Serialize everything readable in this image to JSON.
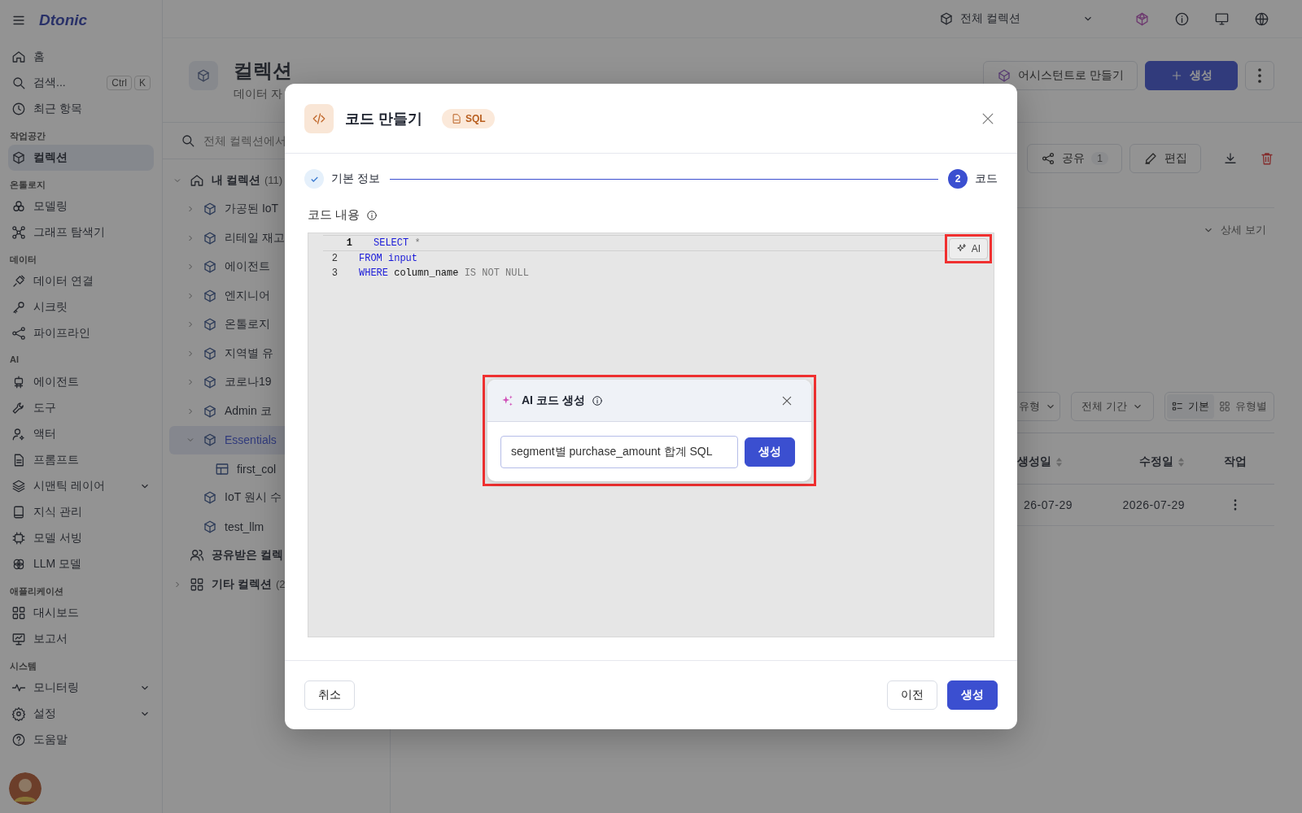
{
  "topbar": {
    "logo": "Dtonic",
    "scope": "전체 컬렉션"
  },
  "sidebar": {
    "groups": [
      {
        "items": [
          {
            "label": "홈",
            "selected": false
          },
          {
            "label": "검색...",
            "selected": false,
            "shortcut": [
              "Ctrl",
              "K"
            ]
          },
          {
            "label": "최근 항목",
            "selected": false
          }
        ]
      },
      {
        "heading": "작업공간",
        "items": [
          {
            "label": "컬렉션",
            "selected": true
          }
        ]
      },
      {
        "heading": "온톨로지",
        "items": [
          {
            "label": "모델링",
            "selected": false
          },
          {
            "label": "그래프 탐색기",
            "selected": false
          }
        ]
      },
      {
        "heading": "데이터",
        "items": [
          {
            "label": "데이터 연결",
            "selected": false
          },
          {
            "label": "시크릿",
            "selected": false
          },
          {
            "label": "파이프라인",
            "selected": false
          }
        ]
      },
      {
        "heading": "AI",
        "items": [
          {
            "label": "에이전트",
            "selected": false
          },
          {
            "label": "도구",
            "selected": false
          },
          {
            "label": "액터",
            "selected": false
          },
          {
            "label": "프롬프트",
            "selected": false
          },
          {
            "label": "시맨틱 레이어",
            "selected": false,
            "expanded": false
          },
          {
            "label": "지식 관리",
            "selected": false
          },
          {
            "label": "모델 서빙",
            "selected": false
          },
          {
            "label": "LLM 모델",
            "selected": false
          }
        ]
      },
      {
        "heading": "애플리케이션",
        "items": [
          {
            "label": "대시보드",
            "selected": false
          },
          {
            "label": "보고서",
            "selected": false
          }
        ]
      },
      {
        "heading": "시스템",
        "items": [
          {
            "label": "모니터링",
            "selected": false,
            "expanded": false
          },
          {
            "label": "설정",
            "selected": false,
            "expanded": false
          },
          {
            "label": "도움말",
            "selected": false
          }
        ]
      }
    ]
  },
  "page_header": {
    "title": "컬렉션",
    "subtitle": "데이터 자",
    "assistant_button": "어시스턴트로 만들기",
    "create_button": "생성"
  },
  "tree": {
    "search_placeholder": "전체 컬렉션에서",
    "roots": [
      {
        "kind": "home",
        "label": "내 컬렉션",
        "count": "(11)",
        "expanded": true,
        "children": [
          {
            "label": "가공된 IoT",
            "expanded": false,
            "selected": false
          },
          {
            "label": "리테일 재고",
            "expanded": false,
            "selected": false
          },
          {
            "label": "에이전트",
            "expanded": false,
            "selected": false
          },
          {
            "label": "엔지니어",
            "expanded": false,
            "selected": false
          },
          {
            "label": "온톨로지",
            "expanded": false,
            "selected": false
          },
          {
            "label": "지역별 유",
            "expanded": false,
            "selected": false
          },
          {
            "label": "코로나19",
            "expanded": false,
            "selected": false
          },
          {
            "label": "Admin 코",
            "expanded": false,
            "selected": false
          },
          {
            "label": "Essentials",
            "expanded": true,
            "selected": true,
            "children": [
              {
                "label": "first_col",
                "kind": "table",
                "selected": false
              }
            ]
          },
          {
            "label": "IoT 원시 수",
            "selected": false
          },
          {
            "label": "test_llm",
            "selected": false
          }
        ]
      },
      {
        "kind": "shared",
        "label": "공유받은 컬렉"
      },
      {
        "kind": "other",
        "label": "기타 컬렉션",
        "count": "(2",
        "expanded": false
      }
    ]
  },
  "detail": {
    "share_button": "공유",
    "share_count": "1",
    "edit_button": "편집",
    "details_toggle": {
      "label": "상세 보기",
      "expanded": false
    },
    "filters": [
      "유형",
      "전체 기간"
    ],
    "views": [
      {
        "label": "기본",
        "selected": true
      },
      {
        "label": "유형별",
        "selected": false
      }
    ],
    "table": {
      "columns": [
        "생성일",
        "수정일",
        "작업"
      ],
      "rows": [
        {
          "created": "26-07-29",
          "modified": "2026-07-29"
        }
      ]
    }
  },
  "modal": {
    "title": "코드 만들기",
    "badge": "SQL",
    "steps": [
      {
        "label": "기본 정보",
        "done": true
      },
      {
        "number": "2",
        "label": "코드",
        "done": false
      }
    ],
    "field_label": "코드 내용",
    "code_lines": [
      {
        "number": "1",
        "active": true,
        "tokens": [
          {
            "text": "SELECT",
            "kind": "keyword"
          },
          {
            "text": " *",
            "kind": "muted"
          }
        ]
      },
      {
        "number": "2",
        "active": false,
        "tokens": [
          {
            "text": "FROM",
            "kind": "keyword"
          },
          {
            "text": " input",
            "kind": "keyword"
          }
        ]
      },
      {
        "number": "3",
        "active": false,
        "tokens": [
          {
            "text": "WHERE",
            "kind": "keyword"
          },
          {
            "text": " column_name",
            "kind": "plain"
          },
          {
            "text": " IS NOT NULL",
            "kind": "muted"
          }
        ]
      }
    ],
    "ai_button": {
      "label": "AI",
      "highlighted": true
    },
    "ai_popup": {
      "title": "AI 코드 생성",
      "value": "segment별 purchase_amount 합계 SQL",
      "submit": "생성",
      "highlighted": true
    },
    "footer": {
      "cancel": "취소",
      "back": "이전",
      "submit": "생성"
    }
  }
}
